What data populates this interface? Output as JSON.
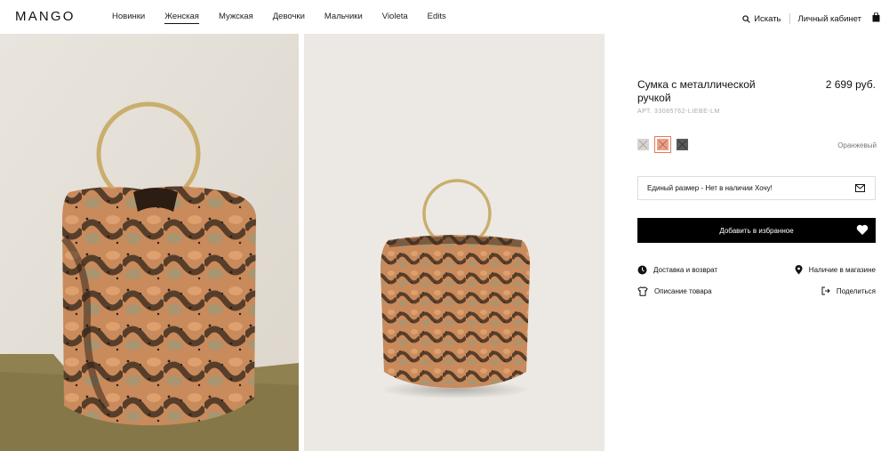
{
  "brand": {
    "logo_text": "MANGO"
  },
  "nav": {
    "items": [
      {
        "label": "Новинки"
      },
      {
        "label": "Женская"
      },
      {
        "label": "Мужская"
      },
      {
        "label": "Девочки"
      },
      {
        "label": "Мальчики"
      },
      {
        "label": "Violeta"
      },
      {
        "label": "Edits"
      }
    ],
    "active_label": "Женская"
  },
  "header": {
    "search_label": "Искать",
    "account_label": "Личный кабинет",
    "icons": [
      "search-icon",
      "shopping-bag-icon"
    ]
  },
  "gallery": {
    "images": [
      {
        "alt": "product-photo-closeup"
      },
      {
        "alt": "product-photo-full"
      }
    ]
  },
  "product": {
    "title": "Сумка с металлической ручкой",
    "price": "2 699 руб.",
    "reference": "АРТ. 33085762-LIEBE-LM",
    "colors": [
      {
        "hex": "#d8d4cf",
        "state": "unavailable"
      },
      {
        "hex": "#e8a288",
        "state": "selected-unavailable"
      },
      {
        "hex": "#5a5a5a",
        "state": "unavailable"
      }
    ],
    "selected_color_name": "Оранжевый",
    "size_notice": "Единый размер - Нет в наличии Хочу!",
    "add_to_favorites_label": "Добавить в избранное",
    "links": {
      "delivery": "Доставка и возврат",
      "store_availability": "Наличие в магазине",
      "description": "Описание товара",
      "share": "Поделиться"
    }
  }
}
